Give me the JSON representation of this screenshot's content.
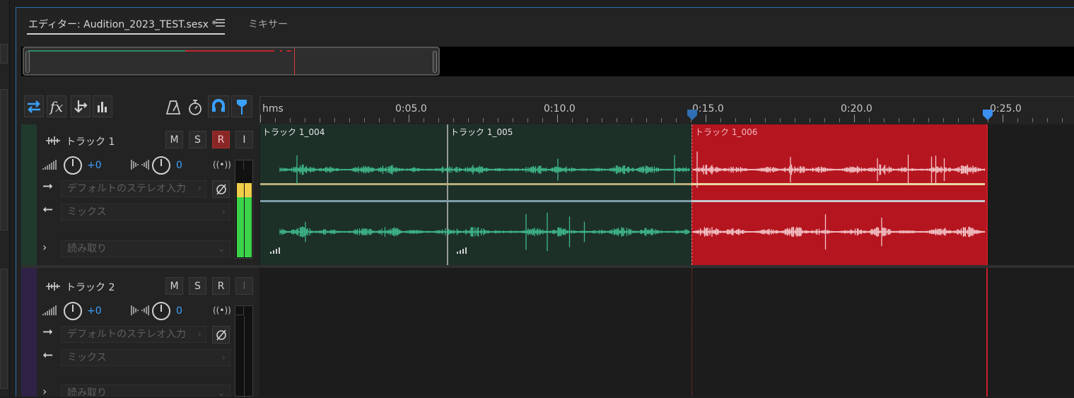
{
  "tabs": {
    "editor_label": "エディター: Audition_2023_TEST.sesx *",
    "mixer_label": "ミキサー"
  },
  "ruler": {
    "unit_label": "hms",
    "labels": [
      "0:05.0",
      "0:10.0",
      "0:15.0",
      "0:20.0",
      "0:25.0"
    ]
  },
  "toolbar": {
    "icons": [
      "swap-icon",
      "fx-icon",
      "merge-down-icon",
      "bars-icon",
      "metronome-icon",
      "timer-icon",
      "snap-magnet-icon",
      "marker-pin-icon"
    ]
  },
  "tracks": [
    {
      "name": "トラック 1",
      "volume": "+0",
      "pan": "0",
      "input": "デフォルトのステレオ入力",
      "output": "ミックス",
      "automation": "読み取り",
      "mute": "M",
      "solo": "S",
      "record": "R",
      "input_monitor": "I",
      "record_armed": true,
      "color": "#1f3b2e"
    },
    {
      "name": "トラック 2",
      "volume": "+0",
      "pan": "0",
      "input": "デフォルトのステレオ入力",
      "output": "ミックス",
      "automation": "読み取り",
      "mute": "M",
      "solo": "S",
      "record": "R",
      "input_monitor": "I",
      "record_armed": false,
      "color": "#2f2246"
    }
  ],
  "clips": [
    {
      "name": "トラック 1_004",
      "color": "#1c3028",
      "selected": false
    },
    {
      "name": "トラック 1_005",
      "color": "#1c3028",
      "selected": false
    },
    {
      "name": "トラック 1_006",
      "color": "#b5151f",
      "selected": true
    }
  ],
  "colors": {
    "accent_blue": "#3aa1ff",
    "wave_green": "#3fb98a",
    "wave_selected": "#f2c4c8",
    "playhead": "#e03a3a"
  }
}
